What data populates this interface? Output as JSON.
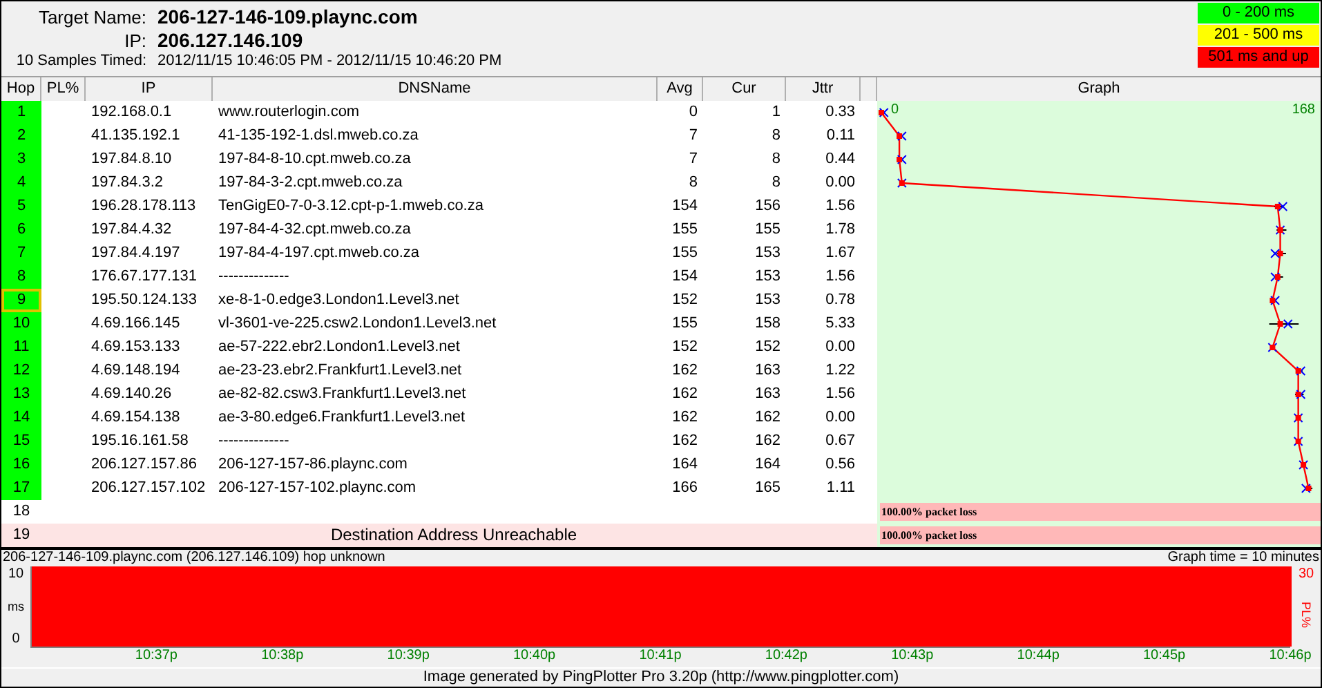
{
  "target": {
    "name_label": "Target Name:",
    "name": "206-127-146-109.plaync.com",
    "ip_label": "IP:",
    "ip": "206.127.146.109",
    "samples_label": "10 Samples Timed:",
    "samples": "2012/11/15 10:46:05 PM - 2012/11/15 10:46:20 PM"
  },
  "legend": [
    {
      "label": "0 - 200 ms",
      "color": "#00ff00"
    },
    {
      "label": "201 - 500 ms",
      "color": "#ffff00"
    },
    {
      "label": "501 ms and up",
      "color": "#ff0000"
    }
  ],
  "columns": [
    "Hop",
    "PL%",
    "IP",
    "DNSName",
    "Avg",
    "Cur",
    "Jttr",
    "Graph"
  ],
  "graph": {
    "min_label": "0",
    "max_label": "168"
  },
  "rows": [
    {
      "kind": "hop",
      "hop": "1",
      "responding": true,
      "selected": false,
      "ip": "192.168.0.1",
      "dns": "www.routerlogin.com",
      "avg": "0",
      "cur": "1",
      "jttr": "0.33"
    },
    {
      "kind": "hop",
      "hop": "2",
      "responding": true,
      "selected": false,
      "ip": "41.135.192.1",
      "dns": "41-135-192-1.dsl.mweb.co.za",
      "avg": "7",
      "cur": "8",
      "jttr": "0.11"
    },
    {
      "kind": "hop",
      "hop": "3",
      "responding": true,
      "selected": false,
      "ip": "197.84.8.10",
      "dns": "197-84-8-10.cpt.mweb.co.za",
      "avg": "7",
      "cur": "8",
      "jttr": "0.44"
    },
    {
      "kind": "hop",
      "hop": "4",
      "responding": true,
      "selected": false,
      "ip": "197.84.3.2",
      "dns": "197-84-3-2.cpt.mweb.co.za",
      "avg": "8",
      "cur": "8",
      "jttr": "0.00"
    },
    {
      "kind": "hop",
      "hop": "5",
      "responding": true,
      "selected": false,
      "ip": "196.28.178.113",
      "dns": "TenGigE0-7-0-3.12.cpt-p-1.mweb.co.za",
      "avg": "154",
      "cur": "156",
      "jttr": "1.56"
    },
    {
      "kind": "hop",
      "hop": "6",
      "responding": true,
      "selected": false,
      "ip": "197.84.4.32",
      "dns": "197-84-4-32.cpt.mweb.co.za",
      "avg": "155",
      "cur": "155",
      "jttr": "1.78"
    },
    {
      "kind": "hop",
      "hop": "7",
      "responding": true,
      "selected": false,
      "ip": "197.84.4.197",
      "dns": "197-84-4-197.cpt.mweb.co.za",
      "avg": "155",
      "cur": "153",
      "jttr": "1.67"
    },
    {
      "kind": "hop",
      "hop": "8",
      "responding": true,
      "selected": false,
      "ip": "176.67.177.131",
      "dns": "--------------",
      "avg": "154",
      "cur": "153",
      "jttr": "1.56"
    },
    {
      "kind": "hop",
      "hop": "9",
      "responding": true,
      "selected": true,
      "ip": "195.50.124.133",
      "dns": "xe-8-1-0.edge3.London1.Level3.net",
      "avg": "152",
      "cur": "153",
      "jttr": "0.78"
    },
    {
      "kind": "hop",
      "hop": "10",
      "responding": true,
      "selected": false,
      "ip": "4.69.166.145",
      "dns": "vl-3601-ve-225.csw2.London1.Level3.net",
      "avg": "155",
      "cur": "158",
      "jttr": "5.33"
    },
    {
      "kind": "hop",
      "hop": "11",
      "responding": true,
      "selected": false,
      "ip": "4.69.153.133",
      "dns": "ae-57-222.ebr2.London1.Level3.net",
      "avg": "152",
      "cur": "152",
      "jttr": "0.00"
    },
    {
      "kind": "hop",
      "hop": "12",
      "responding": true,
      "selected": false,
      "ip": "4.69.148.194",
      "dns": "ae-23-23.ebr2.Frankfurt1.Level3.net",
      "avg": "162",
      "cur": "163",
      "jttr": "1.22"
    },
    {
      "kind": "hop",
      "hop": "13",
      "responding": true,
      "selected": false,
      "ip": "4.69.140.26",
      "dns": "ae-82-82.csw3.Frankfurt1.Level3.net",
      "avg": "162",
      "cur": "163",
      "jttr": "1.56"
    },
    {
      "kind": "hop",
      "hop": "14",
      "responding": true,
      "selected": false,
      "ip": "4.69.154.138",
      "dns": "ae-3-80.edge6.Frankfurt1.Level3.net",
      "avg": "162",
      "cur": "162",
      "jttr": "0.00"
    },
    {
      "kind": "hop",
      "hop": "15",
      "responding": true,
      "selected": false,
      "ip": "195.16.161.58",
      "dns": "--------------",
      "avg": "162",
      "cur": "162",
      "jttr": "0.67"
    },
    {
      "kind": "hop",
      "hop": "16",
      "responding": true,
      "selected": false,
      "ip": "206.127.157.86",
      "dns": "206-127-157-86.plaync.com",
      "avg": "164",
      "cur": "164",
      "jttr": "0.56"
    },
    {
      "kind": "hop",
      "hop": "17",
      "responding": true,
      "selected": false,
      "ip": "206.127.157.102",
      "dns": "206-127-157-102.plaync.com",
      "avg": "166",
      "cur": "165",
      "jttr": "1.11"
    },
    {
      "kind": "lost",
      "hop": "18",
      "responding": false,
      "selected": false,
      "loss": "100.00% packet loss"
    },
    {
      "kind": "unreachable",
      "hop": "19",
      "responding": false,
      "selected": false,
      "message": "Destination Address Unreachable",
      "loss": "100.00% packet loss"
    }
  ],
  "history": {
    "title": "206-127-146-109.plaync.com (206.127.146.109) hop unknown",
    "time_label": "Graph time = 10 minutes",
    "left_ticks": [
      "10",
      "0"
    ],
    "left_unit": "ms",
    "right_tick": "30",
    "right_unit": "PL%",
    "x_ticks": [
      "10:37p",
      "10:38p",
      "10:39p",
      "10:40p",
      "10:41p",
      "10:42p",
      "10:43p",
      "10:44p",
      "10:45p",
      "10:46p"
    ]
  },
  "footer": "Image generated by PingPlotter Pro 3.20p (http://www.pingplotter.com)"
}
